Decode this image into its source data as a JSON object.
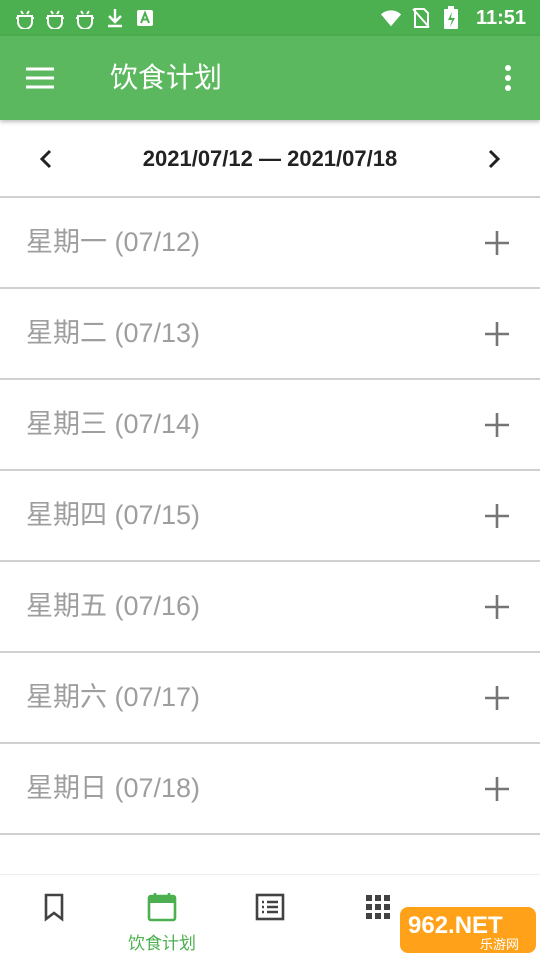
{
  "status_bar": {
    "time": "11:51",
    "left_icons": [
      "bug-icon",
      "bug-icon",
      "bug-icon",
      "download-icon",
      "a-notification-icon"
    ],
    "right_icons": [
      "wifi-icon",
      "no-sim-icon",
      "battery-charging-icon"
    ]
  },
  "toolbar": {
    "title": "饮食计划",
    "menu_icon": "hamburger-menu-icon",
    "more_icon": "more-vertical-icon"
  },
  "week_nav": {
    "range": "2021/07/12 — 2021/07/18"
  },
  "days": [
    {
      "label": "星期一 (07/12)"
    },
    {
      "label": "星期二 (07/13)"
    },
    {
      "label": "星期三 (07/14)"
    },
    {
      "label": "星期四 (07/15)"
    },
    {
      "label": "星期五 (07/16)"
    },
    {
      "label": "星期六 (07/17)"
    },
    {
      "label": "星期日 (07/18)"
    }
  ],
  "bottom_nav": {
    "items": [
      {
        "icon": "bookmark-icon",
        "label": ""
      },
      {
        "icon": "calendar-icon",
        "label": "饮食计划",
        "active": true
      },
      {
        "icon": "list-icon",
        "label": ""
      },
      {
        "icon": "grid-icon",
        "label": ""
      }
    ]
  },
  "watermark": {
    "text": "962.NET",
    "subtext": "乐游网"
  },
  "colors": {
    "primary": "#5cb85f",
    "status_bar": "#4caf50",
    "day_text": "#9e9e9e",
    "active_nav": "#4caf50"
  }
}
